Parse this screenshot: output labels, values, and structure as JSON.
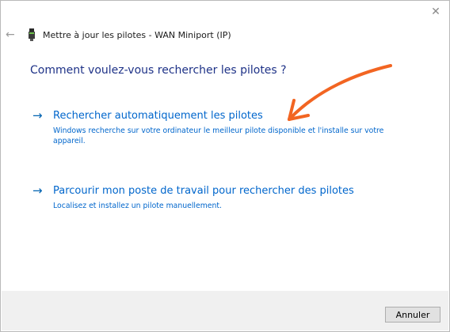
{
  "window": {
    "title": "Mettre à jour les pilotes - WAN Miniport (IP)",
    "close_icon": "close-icon",
    "back_icon": "back-arrow-icon",
    "device_icon": "device-icon"
  },
  "main": {
    "question": "Comment voulez-vous rechercher les pilotes ?",
    "options": [
      {
        "arrow": "→",
        "title": "Rechercher automatiquement les pilotes",
        "description": "Windows recherche sur votre ordinateur le meilleur pilote disponible et l'installe sur votre appareil."
      },
      {
        "arrow": "→",
        "title": "Parcourir mon poste de travail pour rechercher des pilotes",
        "description": "Localisez et installez un pilote manuellement."
      }
    ]
  },
  "footer": {
    "cancel_label": "Annuler"
  },
  "colors": {
    "link": "#0066cc",
    "heading": "#1e3287",
    "annotation": "#f26522",
    "footer_bg": "#f0f0f0"
  }
}
